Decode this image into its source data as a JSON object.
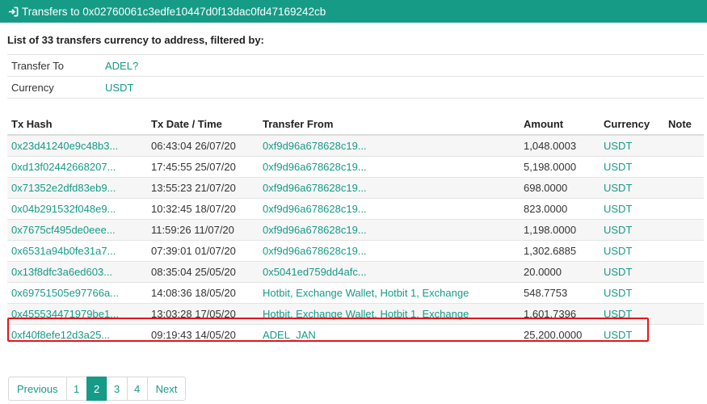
{
  "header": {
    "title": "Transfers to 0x02760061c3edfe10447d0f13dac0fd47169242cb",
    "icon": "sign-in-icon"
  },
  "subtitle": "List of 33 transfers currency to address, filtered by:",
  "filters": [
    {
      "key": "Transfer To",
      "value": "ADEL?"
    },
    {
      "key": "Currency",
      "value": "USDT"
    }
  ],
  "table": {
    "headers": {
      "hash": "Tx Hash",
      "date": "Tx Date / Time",
      "from": "Transfer From",
      "amount": "Amount",
      "currency": "Currency",
      "note": "Note"
    },
    "rows": [
      {
        "hash": "0x23d41240e9c48b3...",
        "date": "06:43:04 26/07/20",
        "from": "0xf9d96a678628c19...",
        "amount": "1,048.0003",
        "currency": "USDT"
      },
      {
        "hash": "0xd13f02442668207...",
        "date": "17:45:55 25/07/20",
        "from": "0xf9d96a678628c19...",
        "amount": "5,198.0000",
        "currency": "USDT"
      },
      {
        "hash": "0x71352e2dfd83eb9...",
        "date": "13:55:23 21/07/20",
        "from": "0xf9d96a678628c19...",
        "amount": "698.0000",
        "currency": "USDT"
      },
      {
        "hash": "0x04b291532f048e9...",
        "date": "10:32:45 18/07/20",
        "from": "0xf9d96a678628c19...",
        "amount": "823.0000",
        "currency": "USDT"
      },
      {
        "hash": "0x7675cf495de0eee...",
        "date": "11:59:26 11/07/20",
        "from": "0xf9d96a678628c19...",
        "amount": "1,198.0000",
        "currency": "USDT"
      },
      {
        "hash": "0x6531a94b0fe31a7...",
        "date": "07:39:01 01/07/20",
        "from": "0xf9d96a678628c19...",
        "amount": "1,302.6885",
        "currency": "USDT"
      },
      {
        "hash": "0x13f8dfc3a6ed603...",
        "date": "08:35:04 25/05/20",
        "from": "0x5041ed759dd4afc...",
        "amount": "20.0000",
        "currency": "USDT"
      },
      {
        "hash": "0x69751505e97766a...",
        "date": "14:08:36 18/05/20",
        "from": "Hotbit, Exchange Wallet, Hotbit 1, Exchange",
        "amount": "548.7753",
        "currency": "USDT"
      },
      {
        "hash": "0x455534471979be1...",
        "date": "13:03:28 17/05/20",
        "from": "Hotbit, Exchange Wallet, Hotbit 1, Exchange",
        "amount": "1,601.7396",
        "currency": "USDT"
      },
      {
        "hash": "0xf40f8efe12d3a25...",
        "date": "09:19:43 14/05/20",
        "from": "ADEL_JAN",
        "amount": "25,200.0000",
        "currency": "USDT"
      }
    ]
  },
  "pagination": {
    "previous": "Previous",
    "pages": [
      "1",
      "2",
      "3",
      "4"
    ],
    "active": "2",
    "next": "Next"
  },
  "colors": {
    "brand": "#169b87",
    "highlight": "#e8141b"
  }
}
